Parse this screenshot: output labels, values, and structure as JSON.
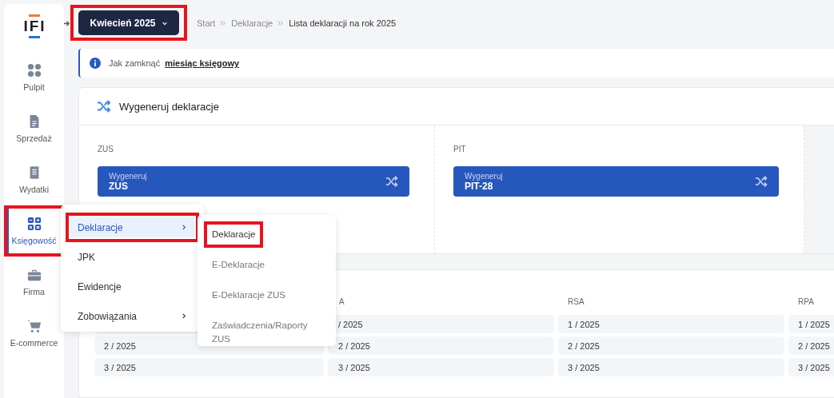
{
  "sidebar": {
    "logo": "IFI",
    "items": [
      {
        "label": "Pulpit",
        "selected": false,
        "highlighted": false
      },
      {
        "label": "Sprzedaż",
        "selected": false,
        "highlighted": false
      },
      {
        "label": "Wydatki",
        "selected": false,
        "highlighted": false
      },
      {
        "label": "Księgowość",
        "selected": true,
        "highlighted": true
      },
      {
        "label": "Firma",
        "selected": false,
        "highlighted": false
      },
      {
        "label": "E-commerce",
        "selected": false,
        "highlighted": false
      }
    ]
  },
  "period_button": {
    "label": "Kwiecień 2025",
    "highlighted": true
  },
  "breadcrumbs": [
    "Start",
    "Deklaracje",
    "Lista deklaracji na rok 2025"
  ],
  "info": {
    "text": "Jak zamknąć",
    "link": "miesiąc księgowy"
  },
  "generate_card": {
    "title": "Wygeneruj deklaracje",
    "sections": [
      {
        "label": "ZUS",
        "button_caption": "Wygeneruj",
        "button_label": "ZUS"
      },
      {
        "label": "PIT",
        "button_caption": "Wygeneruj",
        "button_label": "PIT-28"
      }
    ]
  },
  "table": {
    "columns": [
      null,
      "A",
      "RSA",
      "RPA"
    ],
    "rows": [
      [
        null,
        "/ 2025",
        "1 / 2025",
        "1 / 2025"
      ],
      [
        "2 / 2025",
        "2 / 2025",
        "2 / 2025",
        "2 / 2025"
      ],
      [
        "3 / 2025",
        "3 / 2025",
        "3 / 2025",
        "3 / 2025"
      ]
    ]
  },
  "menu": {
    "items": [
      {
        "label": "Deklaracje",
        "selected": true,
        "highlighted": true,
        "has_submenu": true
      },
      {
        "label": "JPK",
        "selected": false,
        "highlighted": false,
        "has_submenu": false
      },
      {
        "label": "Ewidencje",
        "selected": false,
        "highlighted": false,
        "has_submenu": false
      },
      {
        "label": "Zobowiązania",
        "selected": false,
        "highlighted": false,
        "has_submenu": true
      }
    ]
  },
  "submenu": {
    "items": [
      {
        "label": "Deklaracje",
        "selected": true,
        "highlighted": true
      },
      {
        "label": "E-Deklaracje",
        "selected": false,
        "highlighted": false
      },
      {
        "label": "E-Deklaracje ZUS",
        "selected": false,
        "highlighted": false
      },
      {
        "label": "Zaświadczenia/Raporty ZUS",
        "selected": false,
        "highlighted": false
      }
    ]
  }
}
